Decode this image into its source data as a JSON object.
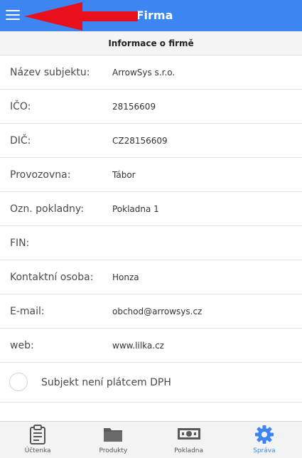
{
  "header": {
    "title": "Firma",
    "menu_icon": "hamburger-menu-icon",
    "annotation_icon": "red-arrow-annotation"
  },
  "section": {
    "title": "Informace o firmě"
  },
  "fields": [
    {
      "label": "Název subjektu:",
      "value": "ArrowSys s.r.o."
    },
    {
      "label": "IČO:",
      "value": "28156609"
    },
    {
      "label": "DIČ:",
      "value": "CZ28156609"
    },
    {
      "label": "Provozovna:",
      "value": "Tábor"
    },
    {
      "label": "Ozn. pokladny:",
      "value": "Pokladna 1"
    },
    {
      "label": "FIN:",
      "value": ""
    },
    {
      "label": "Kontaktní osoba:",
      "value": "Honza"
    },
    {
      "label": "E-mail:",
      "value": "obchod@arrowsys.cz"
    },
    {
      "label": "web:",
      "value": "www.lilka.cz"
    }
  ],
  "vat": {
    "label": "Subjekt není plátcem DPH",
    "checked": false
  },
  "tabs": [
    {
      "label": "Účtenka",
      "icon": "receipt-icon",
      "active": false
    },
    {
      "label": "Produkty",
      "icon": "folder-icon",
      "active": false
    },
    {
      "label": "Pokladna",
      "icon": "cash-icon",
      "active": false
    },
    {
      "label": "Správa",
      "icon": "gear-icon",
      "active": true
    }
  ],
  "colors": {
    "accent": "#3d86f1",
    "annotation": "#e8101c"
  }
}
